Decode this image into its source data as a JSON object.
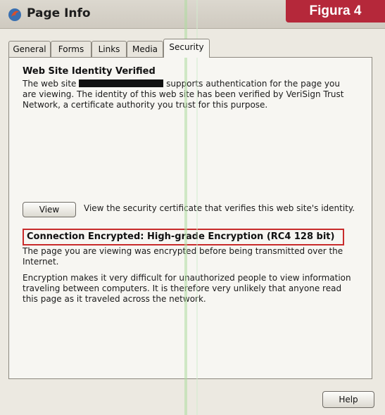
{
  "window": {
    "title": "Page Info"
  },
  "overlay": {
    "figure_label": "Figura 4"
  },
  "tabs": [
    {
      "label": "General",
      "active": false
    },
    {
      "label": "Forms",
      "active": false
    },
    {
      "label": "Links",
      "active": false
    },
    {
      "label": "Media",
      "active": false
    },
    {
      "label": "Security",
      "active": true
    }
  ],
  "security": {
    "identity_heading": "Web Site Identity Verified",
    "identity_line1_start": "The web site",
    "identity_line1_end": "supports authentication for the page you",
    "identity_line2": "are viewing. The identity of this web site has been verified by VeriSign Trust",
    "identity_line3": "Network, a certificate authority you trust for this purpose.",
    "view_button": "View",
    "view_description": "View the security certificate that verifies this web site's identity.",
    "encryption_heading": "Connection Encrypted: High-grade Encryption (RC4 128 bit)",
    "encryption_p1_line1": "The page you are viewing was encrypted before being transmitted over the",
    "encryption_p1_line2": "Internet.",
    "encryption_p2_line1": "Encryption makes it very difficult for unauthorized people to view information",
    "encryption_p2_line2": "traveling between computers. It is therefore very unlikely that anyone read",
    "encryption_p2_line3": "this page as it traveled across the network."
  },
  "footer": {
    "help_button": "Help"
  },
  "colors": {
    "figure_label_bg": "#b5283a",
    "highlight_border": "#c82b2b"
  }
}
